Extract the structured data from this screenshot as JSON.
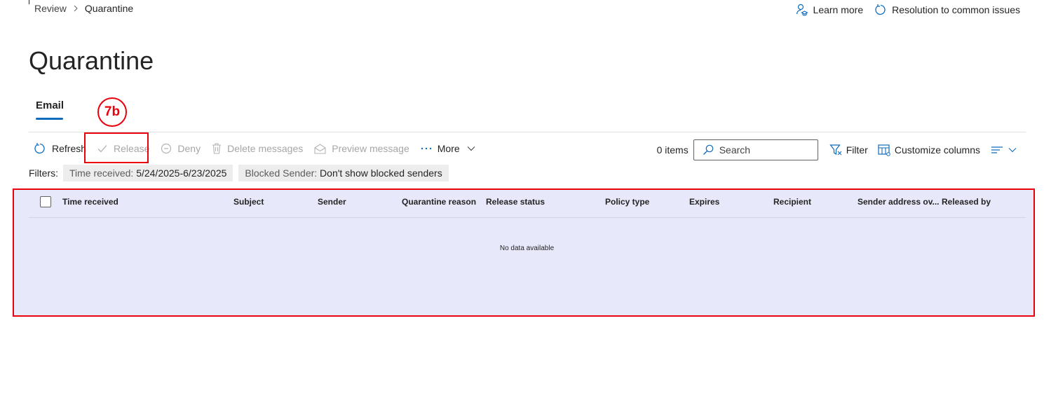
{
  "breadcrumb": {
    "parent": "Review",
    "current": "Quarantine"
  },
  "header_links": {
    "learn_more": "Learn more",
    "resolution": "Resolution to common issues"
  },
  "page": {
    "title": "Quarantine"
  },
  "tabs": {
    "email": "Email"
  },
  "annotation": {
    "callout": "7b"
  },
  "toolbar": {
    "refresh": "Refresh",
    "release": "Release",
    "deny": "Deny",
    "delete": "Delete messages",
    "preview": "Preview message",
    "more": "More",
    "items_count": "0 items",
    "search_placeholder": "Search",
    "filter": "Filter",
    "customize_columns": "Customize columns"
  },
  "filters": {
    "label": "Filters:",
    "chips": [
      {
        "key": "Time received:",
        "value": "5/24/2025-6/23/2025"
      },
      {
        "key": "Blocked Sender:",
        "value": "Don't show blocked senders"
      }
    ]
  },
  "table": {
    "columns": [
      "Time received",
      "Subject",
      "Sender",
      "Quarantine reason",
      "Release status",
      "Policy type",
      "Expires",
      "Recipient",
      "Sender address ov...",
      "Released by"
    ],
    "empty_message": "No data available"
  },
  "colors": {
    "accent": "#0f6cbd",
    "annotation": "#e8000d",
    "table_highlight": "#e8e8fb"
  }
}
